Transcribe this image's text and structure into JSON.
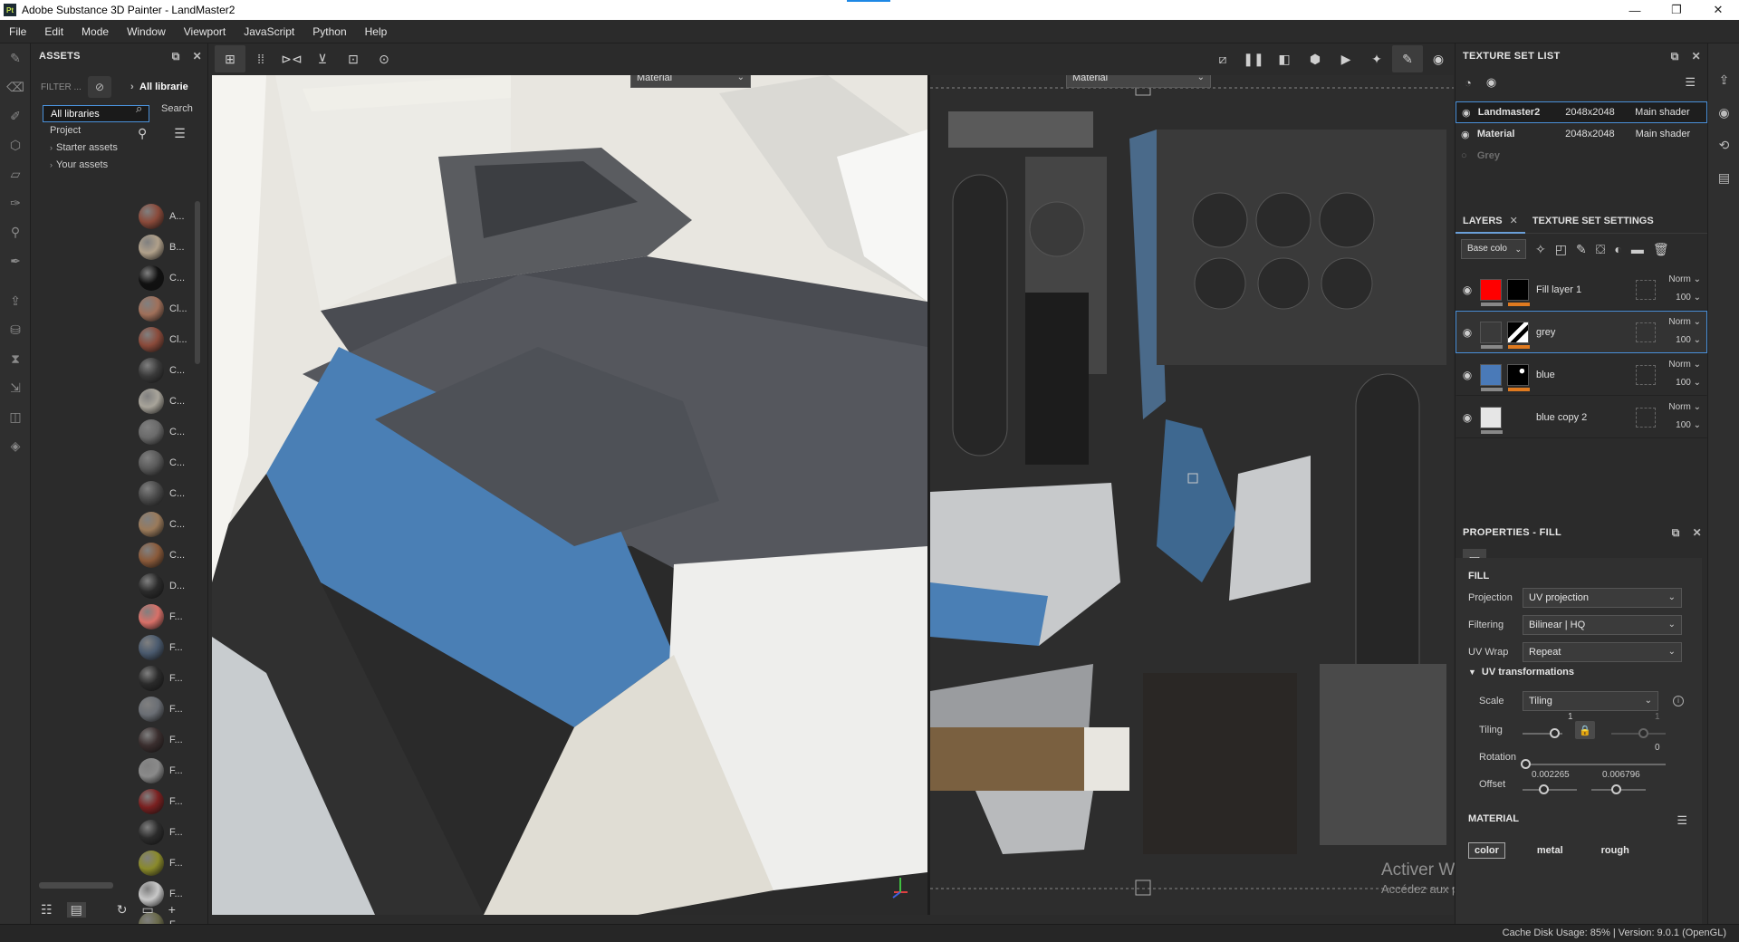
{
  "window": {
    "app_icon": "Pt",
    "title": "Adobe Substance 3D Painter - LandMaster2",
    "controls": [
      "minimize-icon",
      "restore-icon",
      "close-icon"
    ]
  },
  "menu": [
    "File",
    "Edit",
    "Mode",
    "Window",
    "Viewport",
    "JavaScript",
    "Python",
    "Help"
  ],
  "assets": {
    "title": "ASSETS",
    "filter_label": "FILTER ...",
    "libraries": {
      "all": "All libraries",
      "project": "Project",
      "starter": "Starter assets",
      "yours": "Your assets"
    },
    "breadcrumb": "All librarie",
    "search_label": "Search",
    "materials": [
      {
        "label": "A...",
        "color": "#8a4a3a"
      },
      {
        "label": "B...",
        "color": "#b0a08a"
      },
      {
        "label": "C...",
        "color": "#111111"
      },
      {
        "label": "Cl...",
        "color": "#a0705a"
      },
      {
        "label": "Cl...",
        "color": "#8a4a3a"
      },
      {
        "label": "C...",
        "color": "#3a3a3a"
      },
      {
        "label": "C...",
        "color": "#a8a49a"
      },
      {
        "label": "C...",
        "color": "#6a6a6a"
      },
      {
        "label": "C...",
        "color": "#5a5a5a"
      },
      {
        "label": "C...",
        "color": "#4a4a4a"
      },
      {
        "label": "C...",
        "color": "#9a7a5a"
      },
      {
        "label": "C...",
        "color": "#8a5a3a"
      },
      {
        "label": "D...",
        "color": "#2a2a2a"
      },
      {
        "label": "F...",
        "color": "#d87068"
      },
      {
        "label": "F...",
        "color": "#4a5a6e"
      },
      {
        "label": "F...",
        "color": "#2a2a2a"
      },
      {
        "label": "F...",
        "color": "#6a6e74"
      },
      {
        "label": "F...",
        "color": "#3a2e2e"
      },
      {
        "label": "F...",
        "color": "#8a8a8a"
      },
      {
        "label": "F...",
        "color": "#7a2020"
      },
      {
        "label": "F...",
        "color": "#2b2b2b"
      },
      {
        "label": "F...",
        "color": "#8a8a2a"
      },
      {
        "label": "F...",
        "color": "#c8c8c8"
      },
      {
        "label": "F...",
        "color": "#6a6a4a"
      }
    ]
  },
  "viewport": {
    "dropdown_3d": "Material",
    "dropdown_2d": "Material"
  },
  "texture_set_list": {
    "title": "TEXTURE SET LIST",
    "rows": [
      {
        "name": "Landmaster2",
        "res": "2048x2048",
        "shader": "Main shader",
        "selected": true
      },
      {
        "name": "Material",
        "res": "2048x2048",
        "shader": "Main shader",
        "selected": false
      },
      {
        "name": "Grey",
        "res": "",
        "shader": "",
        "selected": false
      }
    ]
  },
  "tabs": {
    "layers": "LAYERS",
    "texture_set_settings": "TEXTURE SET SETTINGS"
  },
  "layers_panel": {
    "channel": "Base colo",
    "layers": [
      {
        "name": "Fill layer 1",
        "blend": "Norm",
        "opacity": "100",
        "thumb": "#ff0000",
        "has_mask": true,
        "mask_style": "black"
      },
      {
        "name": "grey",
        "blend": "Norm",
        "opacity": "100",
        "thumb": "#3a3a3a",
        "has_mask": true,
        "mask_style": "pattern"
      },
      {
        "name": "blue",
        "blend": "Norm",
        "opacity": "100",
        "thumb": "#4a7ab8",
        "has_mask": true,
        "mask_style": "spots"
      },
      {
        "name": "blue copy 2",
        "blend": "Norm",
        "opacity": "100",
        "thumb": "#e6e6e6",
        "has_mask": false,
        "mask_style": "none"
      }
    ]
  },
  "properties": {
    "title": "PROPERTIES - FILL",
    "section": "FILL",
    "projection": {
      "label": "Projection",
      "value": "UV projection"
    },
    "filtering": {
      "label": "Filtering",
      "value": "Bilinear | HQ"
    },
    "uv_wrap": {
      "label": "UV Wrap",
      "value": "Repeat"
    },
    "uv_transformations": "UV transformations",
    "scale": {
      "label": "Scale",
      "value": "Tiling"
    },
    "tiling": {
      "label": "Tiling",
      "value_1": "1",
      "value_2": "1"
    },
    "rotation": {
      "label": "Rotation",
      "value": "0"
    },
    "offset": {
      "label": "Offset",
      "value_1": "0.002265",
      "value_2": "0.006796"
    },
    "material_title": "MATERIAL",
    "material_channels": [
      "color",
      "metal",
      "rough"
    ]
  },
  "watermark": {
    "line1": "Activer Windows",
    "line2": "Accédez aux paramètres pour activer Windows."
  },
  "status": "Cache Disk Usage:   85% | Version: 9.0.1 (OpenGL)"
}
